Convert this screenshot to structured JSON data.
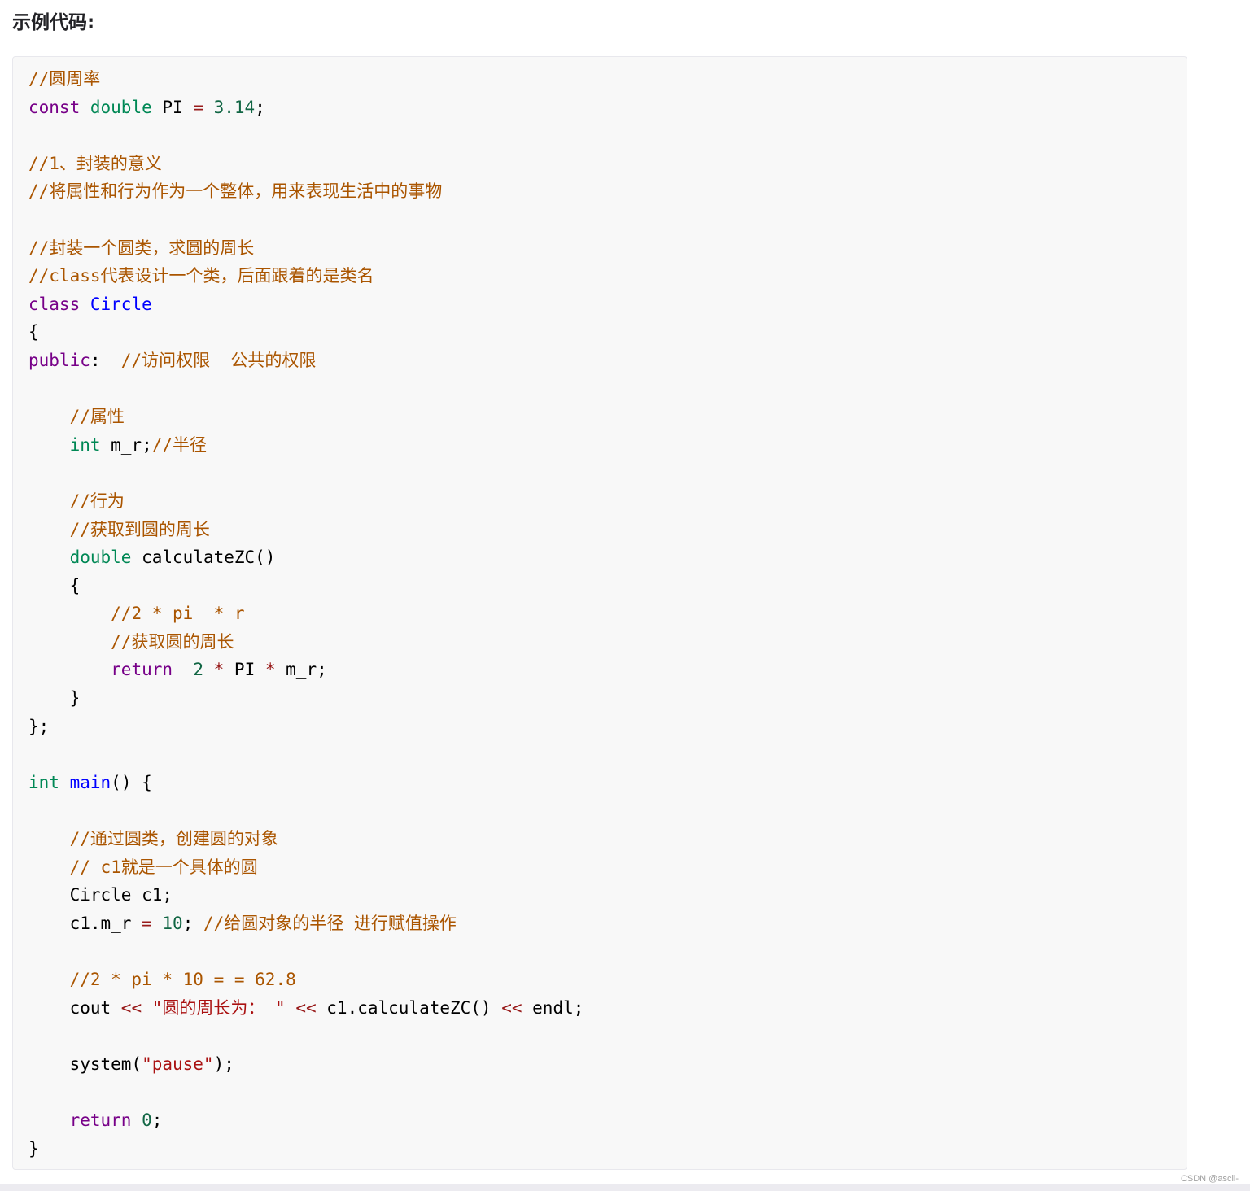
{
  "article": {
    "heading": "示例代码:"
  },
  "code_block": {
    "language": "cpp",
    "colors": {
      "background": "#f8f8f8",
      "comment": "#aa5500",
      "keyword": "#770088",
      "type": "#008855",
      "definition": "#0000ff",
      "number": "#116644",
      "string": "#aa1111",
      "operator": "#981a1a"
    },
    "lines": [
      [
        [
          "comment",
          "//圆周率"
        ]
      ],
      [
        [
          "keyword",
          "const"
        ],
        [
          "plain",
          " "
        ],
        [
          "type",
          "double"
        ],
        [
          "plain",
          " PI "
        ],
        [
          "op",
          "="
        ],
        [
          "plain",
          " "
        ],
        [
          "number",
          "3.14"
        ],
        [
          "plain",
          ";"
        ]
      ],
      [],
      [
        [
          "comment",
          "//1、封装的意义"
        ]
      ],
      [
        [
          "comment",
          "//将属性和行为作为一个整体，用来表现生活中的事物"
        ]
      ],
      [],
      [
        [
          "comment",
          "//封装一个圆类，求圆的周长"
        ]
      ],
      [
        [
          "comment",
          "//class代表设计一个类，后面跟着的是类名"
        ]
      ],
      [
        [
          "keyword",
          "class"
        ],
        [
          "plain",
          " "
        ],
        [
          "def",
          "Circle"
        ]
      ],
      [
        [
          "plain",
          "{"
        ]
      ],
      [
        [
          "keyword",
          "public"
        ],
        [
          "plain",
          ":  "
        ],
        [
          "comment",
          "//访问权限  公共的权限"
        ]
      ],
      [],
      [
        [
          "plain",
          "    "
        ],
        [
          "comment",
          "//属性"
        ]
      ],
      [
        [
          "plain",
          "    "
        ],
        [
          "type",
          "int"
        ],
        [
          "plain",
          " m_r;"
        ],
        [
          "comment",
          "//半径"
        ]
      ],
      [],
      [
        [
          "plain",
          "    "
        ],
        [
          "comment",
          "//行为"
        ]
      ],
      [
        [
          "plain",
          "    "
        ],
        [
          "comment",
          "//获取到圆的周长"
        ]
      ],
      [
        [
          "plain",
          "    "
        ],
        [
          "type",
          "double"
        ],
        [
          "plain",
          " calculateZC()"
        ]
      ],
      [
        [
          "plain",
          "    {"
        ]
      ],
      [
        [
          "plain",
          "        "
        ],
        [
          "comment",
          "//2 * pi  * r"
        ]
      ],
      [
        [
          "plain",
          "        "
        ],
        [
          "comment",
          "//获取圆的周长"
        ]
      ],
      [
        [
          "plain",
          "        "
        ],
        [
          "keyword",
          "return"
        ],
        [
          "plain",
          "  "
        ],
        [
          "number",
          "2"
        ],
        [
          "plain",
          " "
        ],
        [
          "op",
          "*"
        ],
        [
          "plain",
          " PI "
        ],
        [
          "op",
          "*"
        ],
        [
          "plain",
          " m_r;"
        ]
      ],
      [
        [
          "plain",
          "    }"
        ]
      ],
      [
        [
          "plain",
          "};"
        ]
      ],
      [],
      [
        [
          "type",
          "int"
        ],
        [
          "plain",
          " "
        ],
        [
          "def",
          "main"
        ],
        [
          "plain",
          "() {"
        ]
      ],
      [],
      [
        [
          "plain",
          "    "
        ],
        [
          "comment",
          "//通过圆类，创建圆的对象"
        ]
      ],
      [
        [
          "plain",
          "    "
        ],
        [
          "comment",
          "// c1就是一个具体的圆"
        ]
      ],
      [
        [
          "plain",
          "    Circle c1;"
        ]
      ],
      [
        [
          "plain",
          "    c1.m_r "
        ],
        [
          "op",
          "="
        ],
        [
          "plain",
          " "
        ],
        [
          "number",
          "10"
        ],
        [
          "plain",
          "; "
        ],
        [
          "comment",
          "//给圆对象的半径 进行赋值操作"
        ]
      ],
      [],
      [
        [
          "plain",
          "    "
        ],
        [
          "comment",
          "//2 * pi * 10 = = 62.8"
        ]
      ],
      [
        [
          "plain",
          "    cout "
        ],
        [
          "op",
          "<<"
        ],
        [
          "plain",
          " "
        ],
        [
          "string",
          "\"圆的周长为： \""
        ],
        [
          "plain",
          " "
        ],
        [
          "op",
          "<<"
        ],
        [
          "plain",
          " c1.calculateZC() "
        ],
        [
          "op",
          "<<"
        ],
        [
          "plain",
          " endl;"
        ]
      ],
      [],
      [
        [
          "plain",
          "    system("
        ],
        [
          "string",
          "\"pause\""
        ],
        [
          "plain",
          ");"
        ]
      ],
      [],
      [
        [
          "plain",
          "    "
        ],
        [
          "keyword",
          "return"
        ],
        [
          "plain",
          " "
        ],
        [
          "number",
          "0"
        ],
        [
          "plain",
          ";"
        ]
      ],
      [
        [
          "plain",
          "}"
        ]
      ]
    ]
  },
  "watermark": "CSDN @ascii-"
}
